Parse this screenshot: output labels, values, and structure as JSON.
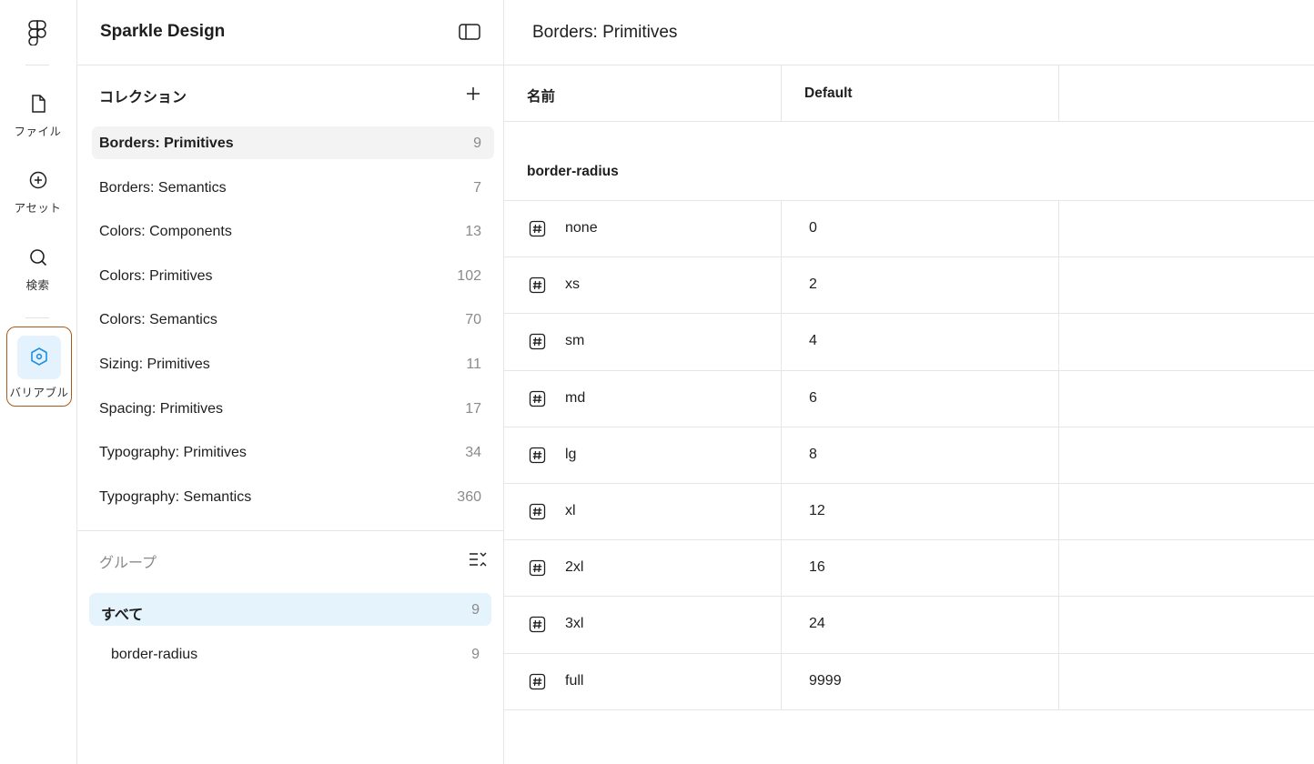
{
  "rail": {
    "items": [
      {
        "label": "ファイル",
        "icon": "file-icon"
      },
      {
        "label": "アセット",
        "icon": "add-circle-icon"
      },
      {
        "label": "検索",
        "icon": "search-icon"
      },
      {
        "label": "バリアブル",
        "icon": "variables-icon"
      }
    ]
  },
  "sidebar": {
    "title": "Sparkle Design",
    "collections_title": "コレクション",
    "collections": [
      {
        "name": "Borders: Primitives",
        "count": "9"
      },
      {
        "name": "Borders: Semantics",
        "count": "7"
      },
      {
        "name": "Colors: Components",
        "count": "13"
      },
      {
        "name": "Colors: Primitives",
        "count": "102"
      },
      {
        "name": "Colors: Semantics",
        "count": "70"
      },
      {
        "name": "Sizing: Primitives",
        "count": "11"
      },
      {
        "name": "Spacing: Primitives",
        "count": "17"
      },
      {
        "name": "Typography: Primitives",
        "count": "34"
      },
      {
        "name": "Typography: Semantics",
        "count": "360"
      }
    ],
    "groups_title": "グループ",
    "groups": [
      {
        "name": "すべて",
        "count": "9"
      },
      {
        "name": "border-radius",
        "count": "9"
      }
    ]
  },
  "main": {
    "title": "Borders: Primitives",
    "columns": [
      "名前",
      "Default"
    ],
    "group_label": "border-radius",
    "rows": [
      {
        "name": "none",
        "value": "0"
      },
      {
        "name": "xs",
        "value": "2"
      },
      {
        "name": "sm",
        "value": "4"
      },
      {
        "name": "md",
        "value": "6"
      },
      {
        "name": "lg",
        "value": "8"
      },
      {
        "name": "xl",
        "value": "12"
      },
      {
        "name": "2xl",
        "value": "16"
      },
      {
        "name": "3xl",
        "value": "24"
      },
      {
        "name": "full",
        "value": "9999"
      }
    ]
  },
  "colors": {
    "accent": "#1e8fe0",
    "selected_bg": "#e5f3fd",
    "highlight_border": "#a85a1a"
  }
}
